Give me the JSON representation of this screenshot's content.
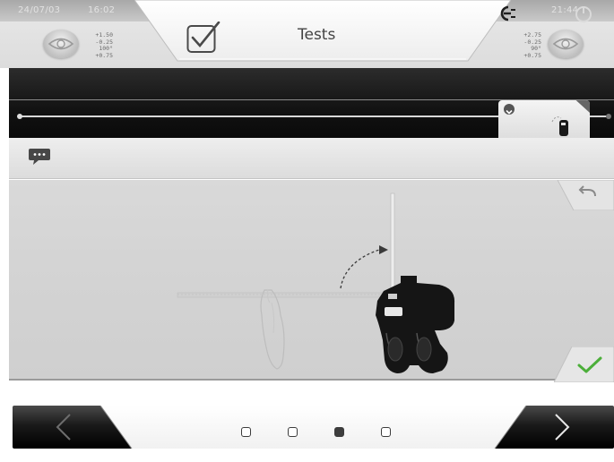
{
  "header": {
    "title": "Tests",
    "date": "24/07/03",
    "time_left": "16:02",
    "clock_right": "21:44",
    "left_eye": {
      "sphere": "+1.50",
      "cylinder": "-0.25",
      "axis": "100°",
      "addition": "+0.75"
    },
    "right_eye": {
      "sphere": "+2.75",
      "cylinder": "-0.25",
      "axis": "90°",
      "addition": "+0.75"
    }
  },
  "pager": {
    "pages": 4,
    "current": 3
  },
  "colors": {
    "accent_check": "#4caf3a",
    "band": "#121212",
    "panel": "#d6d6d6"
  },
  "icons": {
    "title": "checkbox-icon",
    "connection": "connection-icon",
    "power": "power-icon",
    "message": "chat-icon",
    "undo": "undo-icon",
    "confirm": "check-icon",
    "prev": "chevron-left-icon",
    "next": "chevron-right-icon"
  }
}
